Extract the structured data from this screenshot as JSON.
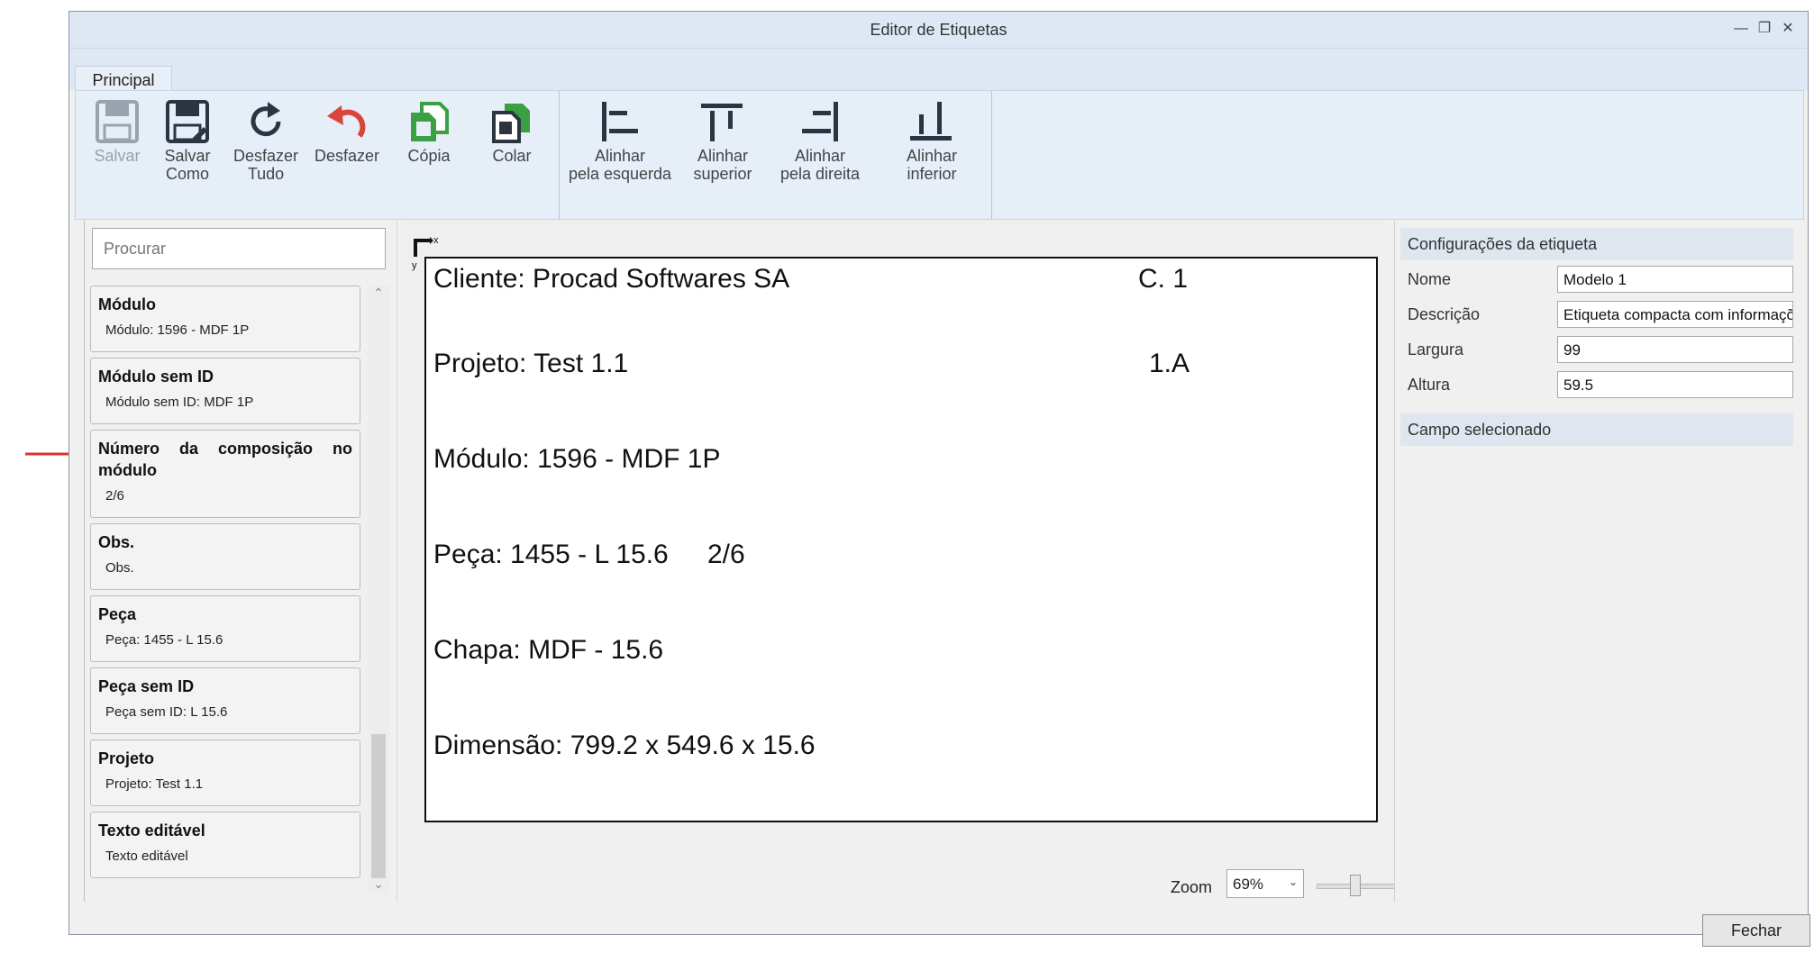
{
  "window": {
    "title": "Editor de Etiquetas"
  },
  "ribbon": {
    "tab": "Principal",
    "buttons": {
      "salvar": [
        "Salvar"
      ],
      "salvar_como": [
        "Salvar",
        "Como"
      ],
      "desfazer_tudo": [
        "Desfazer",
        "Tudo"
      ],
      "desfazer": [
        "Desfazer"
      ],
      "copia": [
        "Cópia"
      ],
      "colar": [
        "Colar"
      ],
      "alinhar_esquerda": [
        "Alinhar",
        "pela esquerda"
      ],
      "alinhar_superior": [
        "Alinhar",
        "superior"
      ],
      "alinhar_direita": [
        "Alinhar",
        "pela direita"
      ],
      "alinhar_inferior": [
        "Alinhar",
        "inferior"
      ]
    }
  },
  "fields": {
    "search_placeholder": "Procurar",
    "items": [
      {
        "title": "Módulo",
        "sub": "Módulo: 1596 - MDF 1P"
      },
      {
        "title": "Módulo sem ID",
        "sub": "Módulo sem ID: MDF 1P"
      },
      {
        "title": "Número da composição no",
        "title2": "módulo",
        "sub": "2/6"
      },
      {
        "title": "Obs.",
        "sub": "Obs."
      },
      {
        "title": "Peça",
        "sub": "Peça: 1455 - L 15.6"
      },
      {
        "title": "Peça sem ID",
        "sub": "Peça sem ID: L 15.6"
      },
      {
        "title": "Projeto",
        "sub": "Projeto: Test 1.1"
      },
      {
        "title": "Texto editável",
        "sub": "Texto editável"
      }
    ]
  },
  "canvas": {
    "axis_x": "x",
    "axis_y": "y",
    "label_lines": {
      "cliente": "Cliente: Procad Softwares SA",
      "c1": "C. 1",
      "projeto": "Projeto: Test 1.1",
      "a1": "1.A",
      "modulo": "Módulo: 1596 - MDF 1P",
      "peca": "Peça: 1455 - L 15.6",
      "composicao": "2/6",
      "chapa": "Chapa: MDF - 15.6",
      "dimensao": "Dimensão: 799.2 x 549.6 x 15.6"
    }
  },
  "zoom": {
    "label": "Zoom",
    "value": "69%",
    "slider_value": 0.3
  },
  "config": {
    "section_title": "Configurações da etiqueta",
    "nome_label": "Nome",
    "nome_value": "Modelo 1",
    "descricao_label": "Descrição",
    "descricao_value": "Etiqueta compacta com informações",
    "largura_label": "Largura",
    "largura_value": "99",
    "altura_label": "Altura",
    "altura_value": "59.5",
    "selected_section": "Campo selecionado"
  },
  "footer": {
    "close_label": "Fechar"
  },
  "colors": {
    "accent_red": "#e0302a",
    "copy_green": "#3aa043",
    "ribbon_bg": "#e6eef8"
  },
  "icons": [
    "save-icon",
    "save-as-icon",
    "redo-all-icon",
    "undo-icon",
    "copy-icon",
    "paste-icon",
    "align-left-icon",
    "align-top-icon",
    "align-right-icon",
    "align-bottom-icon"
  ]
}
